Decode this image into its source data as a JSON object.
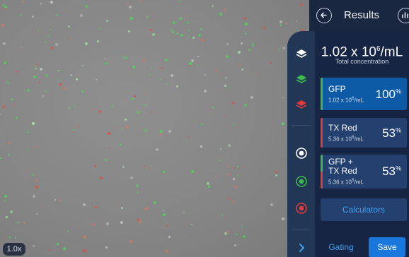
{
  "image": {
    "zoom_label": "1.0x"
  },
  "header": {
    "title": "Results",
    "back_icon": "arrow-left-icon",
    "chart_icon": "bar-chart-icon"
  },
  "summary": {
    "concentration_base": "1.02 x 10",
    "concentration_exp": "6",
    "concentration_unit": "/mL",
    "label": "Total concentration"
  },
  "channels": [
    {
      "name": "GFP",
      "conc_base": "1.02 x 10",
      "conc_exp": "6",
      "conc_unit": "/mL",
      "percent": "100",
      "percent_unit": "%",
      "color": "#3dbb4a",
      "active": true
    },
    {
      "name": "TX Red",
      "conc_base": "5.36 x 10",
      "conc_exp": "5",
      "conc_unit": "/mL",
      "percent": "53",
      "percent_unit": "%",
      "color": "#e03b3b",
      "active": false
    },
    {
      "name_line1": "GFP +",
      "name_line2": "TX Red",
      "conc_base": "5.36 x 10",
      "conc_exp": "5",
      "conc_unit": "/mL",
      "percent": "53",
      "percent_unit": "%",
      "colors": [
        "#3dbb4a",
        "#e03b3b"
      ],
      "active": false
    }
  ],
  "rail": {
    "layer_icons": [
      "layers-white-icon",
      "layers-green-icon",
      "layers-red-icon"
    ],
    "view_icons": [
      "target-white-icon",
      "target-green-icon",
      "target-red-icon"
    ],
    "expand_icon": "chevron-right-icon",
    "colors": {
      "white": "#ffffff",
      "green": "#3dbb4a",
      "red": "#e03b3b",
      "accent": "#3fa0f0"
    }
  },
  "buttons": {
    "calculators": "Calculators",
    "gating": "Gating",
    "save": "Save"
  }
}
